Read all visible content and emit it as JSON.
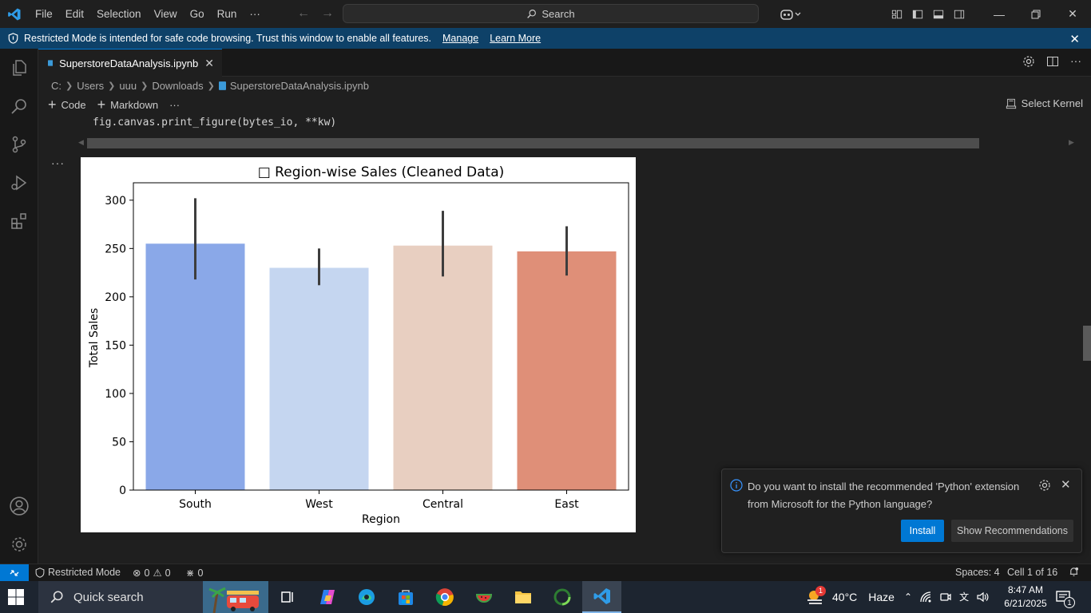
{
  "titlebar": {
    "menu": [
      "File",
      "Edit",
      "Selection",
      "View",
      "Go",
      "Run"
    ],
    "more": "···",
    "search_label": "Search"
  },
  "banner": {
    "text": "Restricted Mode is intended for safe code browsing. Trust this window to enable all features.",
    "manage": "Manage",
    "learn_more": "Learn More"
  },
  "tab": {
    "label": "SuperstoreDataAnalysis.ipynb"
  },
  "breadcrumb": [
    "C:",
    "Users",
    "uuu",
    "Downloads",
    "SuperstoreDataAnalysis.ipynb"
  ],
  "toolbar": {
    "code": "Code",
    "markdown": "Markdown",
    "more": "···",
    "kernel": "Select Kernel"
  },
  "editor": {
    "code_line": "fig.canvas.print_figure(bytes_io, **kw)",
    "cell_more": "···"
  },
  "chart_data": {
    "type": "bar",
    "title": "□ Region-wise Sales (Cleaned Data)",
    "xlabel": "Region",
    "ylabel": "Total Sales",
    "categories": [
      "South",
      "West",
      "Central",
      "East"
    ],
    "values": [
      255,
      230,
      253,
      247
    ],
    "error_low": [
      218,
      212,
      221,
      222
    ],
    "error_high": [
      302,
      250,
      289,
      273
    ],
    "colors": [
      "#8aa8e8",
      "#c5d6f0",
      "#e8cfc1",
      "#df8f78"
    ],
    "yticks": [
      0,
      50,
      100,
      150,
      200,
      250,
      300
    ],
    "ylim": [
      0,
      318
    ],
    "grid": false
  },
  "notification": {
    "message": "Do you want to install the recommended 'Python' extension from Microsoft for the Python language?",
    "install": "Install",
    "show_recs": "Show Recommendations"
  },
  "statusbar": {
    "restricted": "Restricted Mode",
    "errors": "0",
    "warnings": "0",
    "ports": "0",
    "spaces": "Spaces: 4",
    "cell": "Cell 1 of 16"
  },
  "taskbar": {
    "search": "Quick search",
    "temperature": "40°C",
    "weather": "Haze",
    "time": "8:47 AM",
    "date": "6/21/2025",
    "weather_badge": "1",
    "notif_badge": "1"
  }
}
